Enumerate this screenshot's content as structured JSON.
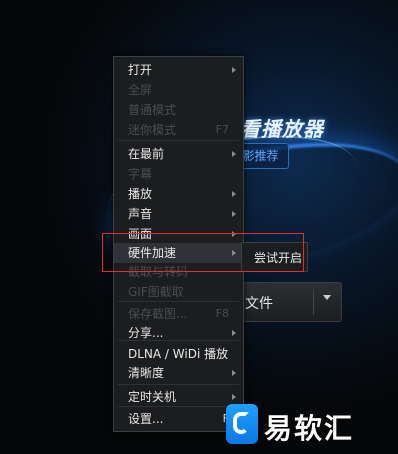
{
  "background": {
    "player_title": "看播放器",
    "recommend_label": "影推荐"
  },
  "open_file_button": {
    "label": "文件"
  },
  "context_menu": {
    "items": [
      {
        "label": "打开",
        "enabled": true,
        "has_submenu": true,
        "shortcut": ""
      },
      {
        "label": "全屏",
        "enabled": false,
        "has_submenu": false,
        "shortcut": ""
      },
      {
        "label": "普通模式",
        "enabled": false,
        "has_submenu": false,
        "shortcut": ""
      },
      {
        "label": "迷你模式",
        "enabled": false,
        "has_submenu": false,
        "shortcut": "F7"
      },
      {
        "label": "在最前",
        "enabled": true,
        "has_submenu": true,
        "shortcut": ""
      },
      {
        "label": "字幕",
        "enabled": false,
        "has_submenu": false,
        "shortcut": ""
      },
      {
        "label": "播放",
        "enabled": true,
        "has_submenu": true,
        "shortcut": ""
      },
      {
        "label": "声音",
        "enabled": true,
        "has_submenu": true,
        "shortcut": ""
      },
      {
        "label": "画面",
        "enabled": true,
        "has_submenu": true,
        "shortcut": ""
      },
      {
        "label": "硬件加速",
        "enabled": true,
        "has_submenu": true,
        "shortcut": "",
        "hovered": true
      },
      {
        "label": "截取与转码",
        "enabled": false,
        "has_submenu": false,
        "shortcut": ""
      },
      {
        "label": "GIF图截取",
        "enabled": false,
        "has_submenu": false,
        "shortcut": ""
      },
      {
        "label": "保存截图...",
        "enabled": false,
        "has_submenu": false,
        "shortcut": "F8"
      },
      {
        "label": "分享...",
        "enabled": true,
        "has_submenu": true,
        "shortcut": ""
      },
      {
        "label": "DLNA / WiDi 播放",
        "enabled": true,
        "has_submenu": false,
        "shortcut": ""
      },
      {
        "label": "清晰度",
        "enabled": true,
        "has_submenu": true,
        "shortcut": ""
      },
      {
        "label": "定时关机",
        "enabled": true,
        "has_submenu": true,
        "shortcut": ""
      },
      {
        "label": "设置...",
        "enabled": true,
        "has_submenu": false,
        "shortcut": "F"
      }
    ]
  },
  "submenu": {
    "label": "尝试开启"
  },
  "watermark": {
    "text": "易软汇",
    "logo_icon": "e-logo-icon"
  },
  "colors": {
    "accent": "#1f8fff",
    "highlight_box": "#e0302a"
  }
}
